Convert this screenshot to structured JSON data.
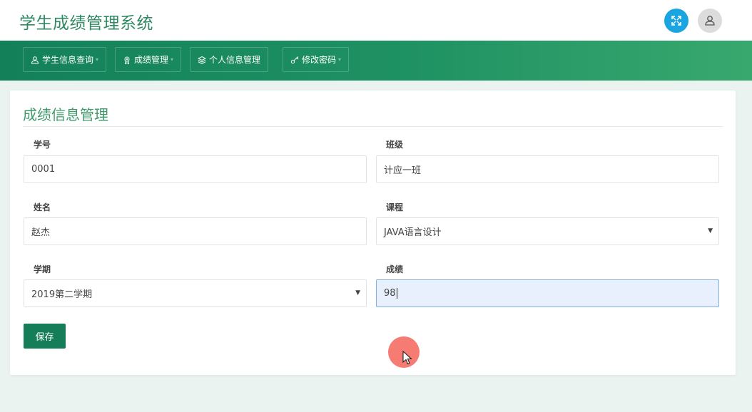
{
  "app": {
    "title": "学生成绩管理系统"
  },
  "header": {
    "expand_icon": "fullscreen-icon",
    "user_icon": "user-icon"
  },
  "nav": {
    "items": [
      {
        "label": "学生信息查询",
        "icon": "user-icon",
        "has_dropdown": true
      },
      {
        "label": "成绩管理",
        "icon": "award-icon",
        "has_dropdown": true
      },
      {
        "label": "个人信息管理",
        "icon": "layers-icon",
        "has_dropdown": false
      },
      {
        "label": "修改密码",
        "icon": "key-icon",
        "has_dropdown": true
      }
    ]
  },
  "panel": {
    "title": "成绩信息管理",
    "fields": {
      "student_id": {
        "label": "学号",
        "value": "0001"
      },
      "class": {
        "label": "班级",
        "value": "计应一班"
      },
      "name": {
        "label": "姓名",
        "value": "赵杰"
      },
      "course": {
        "label": "课程",
        "value": "JAVA语言设计"
      },
      "semester": {
        "label": "学期",
        "value": "2019第二学期"
      },
      "score": {
        "label": "成绩",
        "value": "98"
      }
    },
    "save_label": "保存"
  },
  "colors": {
    "brand_green": "#2f8a63",
    "nav_start": "#13805a",
    "nav_end": "#39a86f",
    "accent_blue": "#1ba5e0",
    "button_green": "#167d59",
    "focus_bg": "#e8f0fe"
  }
}
